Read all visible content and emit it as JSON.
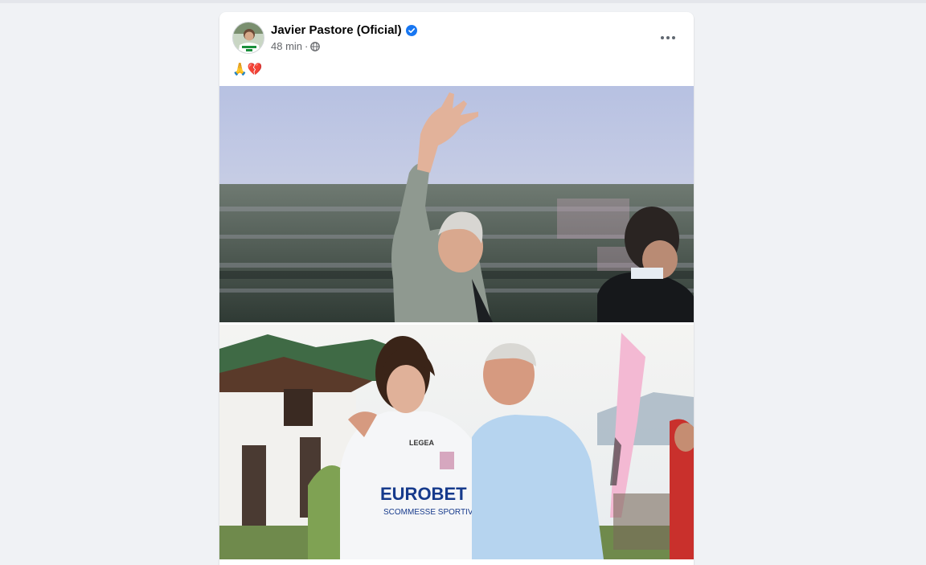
{
  "post": {
    "author": "Javier Pastore (Oficial)",
    "time": "48 min",
    "separator": "·",
    "text": "🙏💔",
    "icons": {
      "verified": "verified-badge-icon",
      "audience": "globe-icon",
      "more": "more-options-icon"
    },
    "photos": [
      {
        "name": "stadium-wave-photo"
      },
      {
        "name": "embrace-jersey-photo",
        "jersey_brand": "LEGEA",
        "jersey_sponsor": "EUROBET",
        "jersey_subline": "SCOMMESSE SPORTIVE"
      }
    ]
  },
  "colors": {
    "background": "#f0f2f5",
    "card": "#ffffff",
    "verified": "#1877f2",
    "meta_text": "#65676b"
  }
}
